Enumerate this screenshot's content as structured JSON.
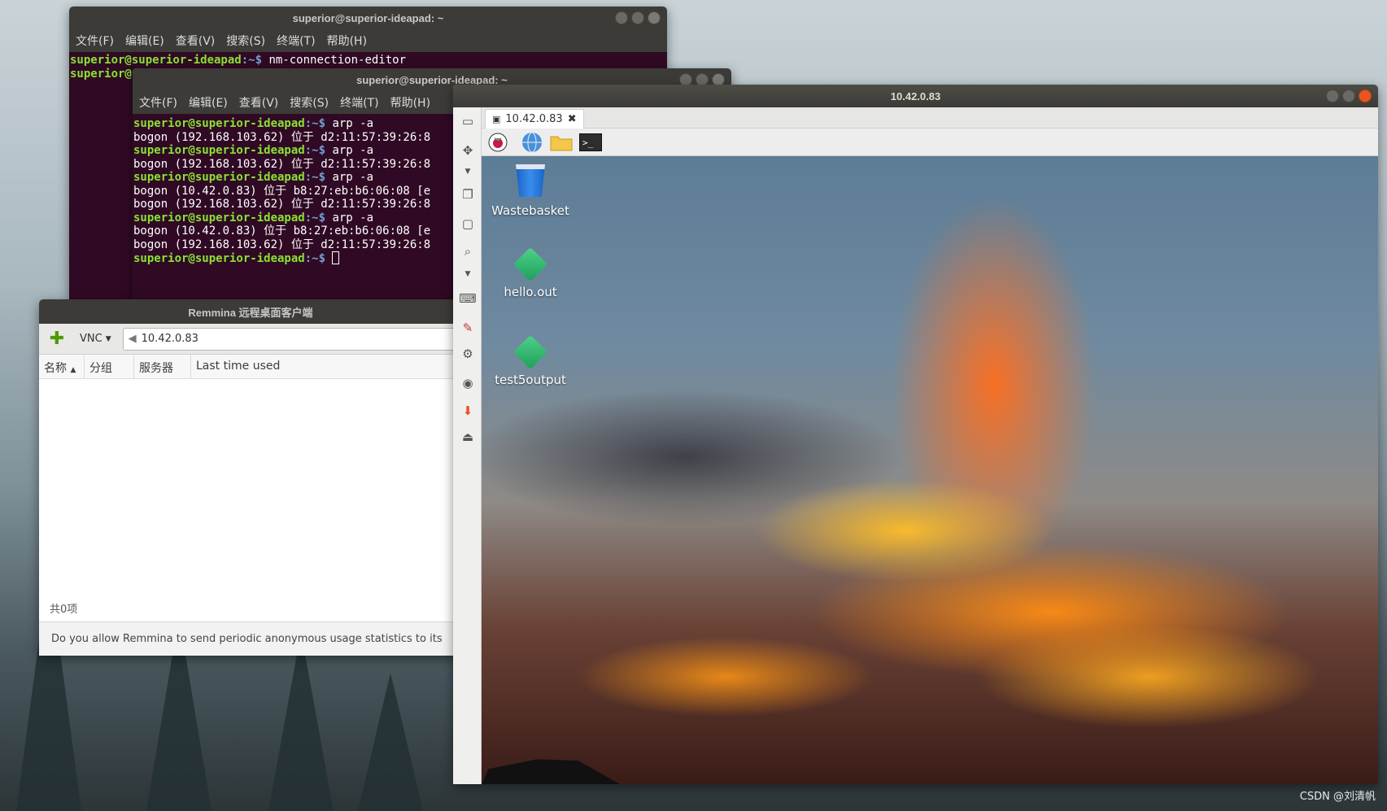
{
  "background": {
    "watermark": "CSDN @刘清帆"
  },
  "terminal1": {
    "title": "superior@superior-ideapad: ~",
    "menu": [
      "文件(F)",
      "编辑(E)",
      "查看(V)",
      "搜索(S)",
      "终端(T)",
      "帮助(H)"
    ],
    "line1_prompt": "superior@superior-ideapad",
    "line1_path": ":~$",
    "line1_cmd": " nm-connection-editor",
    "line2_prompt": "superior@"
  },
  "terminal2": {
    "title": "superior@superior-ideapad: ~",
    "menu": [
      "文件(F)",
      "编辑(E)",
      "查看(V)",
      "搜索(S)",
      "终端(T)",
      "帮助(H)"
    ],
    "prompt": "superior@superior-ideapad",
    "path": ":~$",
    "cmd": " arp -a",
    "out_a": "bogon (192.168.103.62) 位于 d2:11:57:39:26:8",
    "out_b": "bogon (10.42.0.83) 位于 b8:27:eb:b6:06:08 [e"
  },
  "remmina": {
    "title": "Remmina 远程桌面客户端",
    "protocol": "VNC",
    "address": "10.42.0.83",
    "columns": [
      "名称",
      "分组",
      "服务器",
      "Last time used"
    ],
    "status": "共0项",
    "message": "Do you allow Remmina to send periodic anonymous usage statistics to its"
  },
  "vnc": {
    "title": "10.42.0.83",
    "tab_label": "10.42.0.83",
    "desktop_icons": [
      "Wastebasket",
      "hello.out",
      "test5output"
    ]
  },
  "colors": {
    "terminal_bg": "#300a24",
    "prompt_green": "#8ae234",
    "accent": "#e95420"
  }
}
